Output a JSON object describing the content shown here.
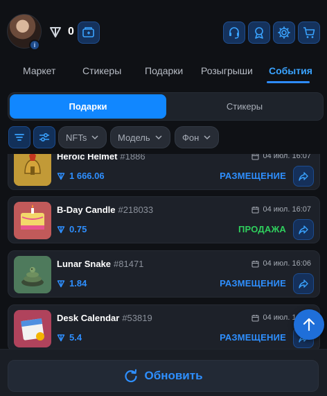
{
  "header": {
    "balance": "0",
    "avatar_badge": "i"
  },
  "tabs": [
    {
      "label": "Маркет"
    },
    {
      "label": "Стикеры"
    },
    {
      "label": "Подарки"
    },
    {
      "label": "Розыгрыши"
    },
    {
      "label": "События",
      "active": true
    }
  ],
  "segment": {
    "active": "Подарки",
    "inactive": "Стикеры"
  },
  "filters": {
    "nfts": "NFTs",
    "model": "Модель",
    "background": "Фон"
  },
  "items": [
    {
      "name": "Heroic Helmet",
      "num": "#1886",
      "date": "04 июл. 16:07",
      "price": "1 666.06",
      "status": "РАЗМЕЩЕНИЕ",
      "status_type": "place"
    },
    {
      "name": "B-Day Candle",
      "num": "#218033",
      "date": "04 июл. 16:07",
      "price": "0.75",
      "status": "ПРОДАЖА",
      "status_type": "sale"
    },
    {
      "name": "Lunar Snake",
      "num": "#81471",
      "date": "04 июл. 16:06",
      "price": "1.84",
      "status": "РАЗМЕЩЕНИЕ",
      "status_type": "place"
    },
    {
      "name": "Desk Calendar",
      "num": "#53819",
      "date": "04 июл. 16:06",
      "price": "5.4",
      "status": "РАЗМЕЩЕНИЕ",
      "status_type": "place"
    }
  ],
  "bottom": {
    "refresh_label": "Обновить"
  },
  "colors": {
    "accent": "#1187ff",
    "sale": "#2fd05d",
    "background": "#0f1115"
  }
}
